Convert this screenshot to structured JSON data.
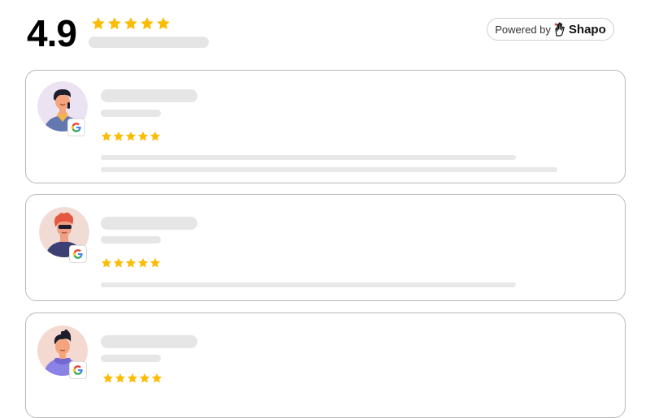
{
  "header": {
    "rating_value": "4.9",
    "stars": 5,
    "powered_by": {
      "prefix": "Powered by",
      "brand": "Shapo",
      "icon": "shapo-hand-icon"
    }
  },
  "reviews": [
    {
      "source": "google",
      "source_icon": "google-g-icon",
      "stars": 5,
      "avatar": "avatar-dark-hair-man"
    },
    {
      "source": "google",
      "source_icon": "google-g-icon",
      "stars": 5,
      "avatar": "avatar-red-hair-sunglasses"
    },
    {
      "source": "google",
      "source_icon": "google-g-icon",
      "stars": 5,
      "avatar": "avatar-purple-hoodie"
    }
  ],
  "colors": {
    "star": "#fbbc04",
    "placeholder": "#e6e6e6",
    "card_border": "#b9b9b9",
    "google_blue": "#4285f4",
    "google_red": "#ea4335",
    "google_yellow": "#fbbc05",
    "google_green": "#34a853"
  }
}
